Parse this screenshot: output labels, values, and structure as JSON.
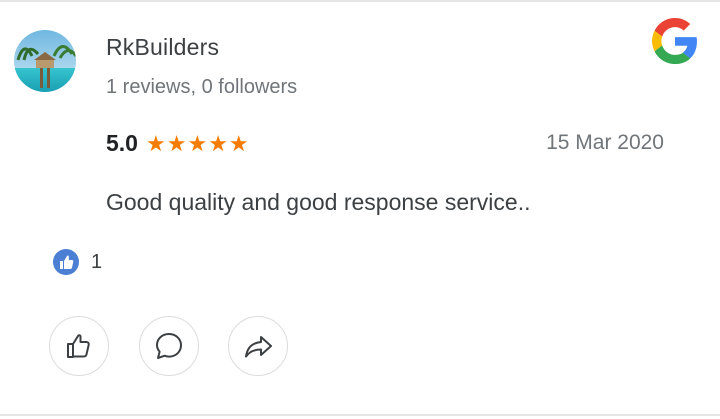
{
  "review": {
    "reviewer_name": "RkBuilders",
    "reviewer_meta": "1 reviews, 0 followers",
    "rating": "5.0",
    "stars": 5,
    "star_color": "#f57c00",
    "date": "15 Mar 2020",
    "text": "Good quality and good response service..",
    "like_count": "1"
  },
  "icons": {
    "source": "google-logo-icon",
    "like_badge": "thumbs-up-icon",
    "actions": [
      "thumbs-up-icon",
      "comment-icon",
      "share-icon"
    ]
  },
  "colors": {
    "like_badge": "#4a7fd4",
    "text_primary": "#3c4043",
    "text_secondary": "#70757a"
  }
}
